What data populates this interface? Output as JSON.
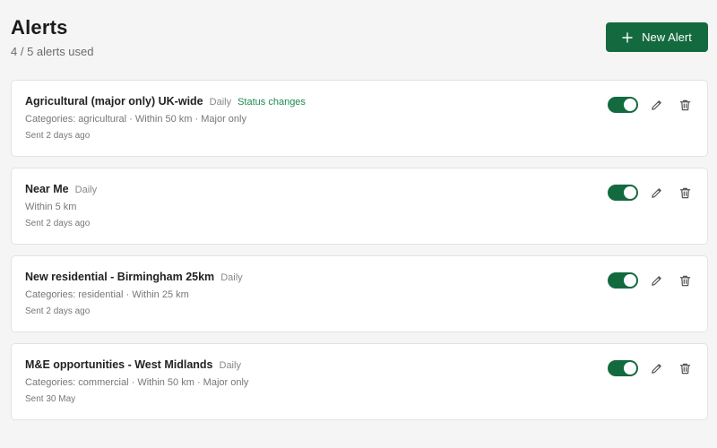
{
  "header": {
    "title": "Alerts",
    "usage": "4 / 5 alerts used",
    "new_button_label": "New Alert"
  },
  "alerts": [
    {
      "name": "Agricultural (major only) UK-wide",
      "frequency": "Daily",
      "extra": "Status changes",
      "details": "Categories: agricultural · Within 50 km · Major only",
      "sent": "Sent 2 days ago",
      "enabled": true
    },
    {
      "name": "Near Me",
      "frequency": "Daily",
      "details": "Within 5 km",
      "sent": "Sent 2 days ago",
      "enabled": true
    },
    {
      "name": "New residential - Birmingham 25km",
      "frequency": "Daily",
      "details": "Categories: residential · Within 25 km",
      "sent": "Sent 2 days ago",
      "enabled": true
    },
    {
      "name": "M&E opportunities - West Midlands",
      "frequency": "Daily",
      "details": "Categories: commercial · Within 50 km · Major only",
      "sent": "Sent 30 May",
      "enabled": true
    }
  ],
  "icons": {
    "new": "plus-icon",
    "edit": "pencil-icon",
    "delete": "trash-icon"
  },
  "colors": {
    "accent": "#136a3f",
    "status_link": "#1f8a55"
  }
}
